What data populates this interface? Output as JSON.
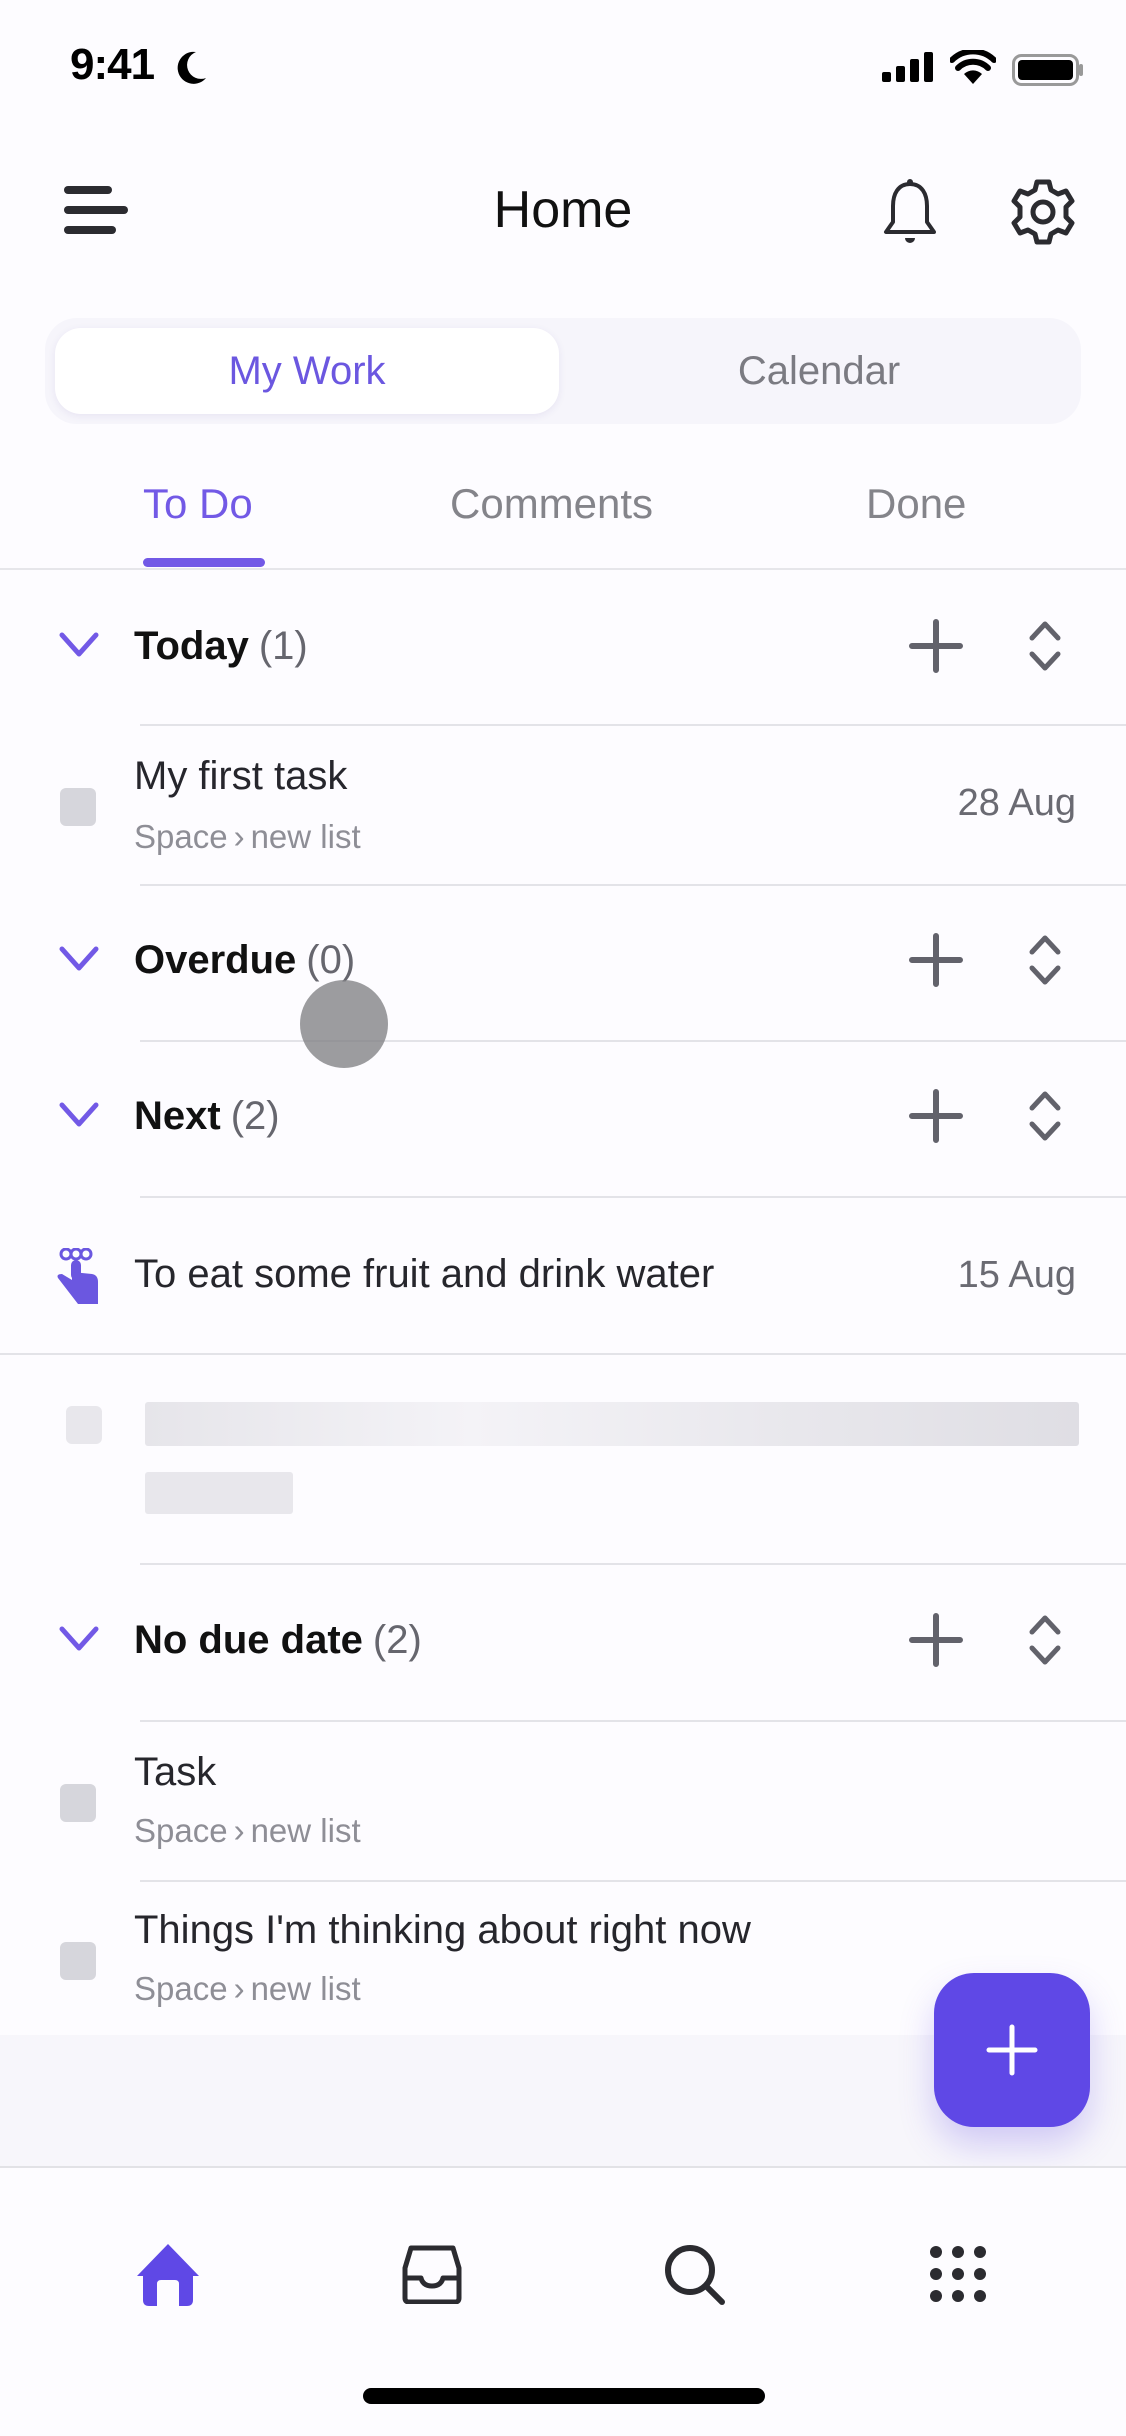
{
  "status_bar": {
    "time": "9:41",
    "focus_icon": "moon-icon",
    "signal": "signal-icon",
    "wifi": "wifi-icon",
    "battery": "battery-icon"
  },
  "header": {
    "title": "Home",
    "menu_icon": "hamburger-icon",
    "notifications_icon": "bell-icon",
    "settings_icon": "gear-icon"
  },
  "segmented": {
    "options": [
      "My Work",
      "Calendar"
    ],
    "selected": "My Work"
  },
  "tabs": {
    "items": [
      "To Do",
      "Comments",
      "Done"
    ],
    "active": "To Do"
  },
  "colors": {
    "accent": "#7259e6",
    "fab": "#5f48e6",
    "text": "#1f1f24",
    "muted": "#8e8e96"
  },
  "sections": [
    {
      "title": "Today",
      "count": "(1)",
      "tasks": [
        {
          "title": "My first task",
          "space": "Space",
          "list": "new list",
          "date": "28 Aug",
          "icon": "checkbox"
        }
      ]
    },
    {
      "title": "Overdue",
      "count": "(0)",
      "tasks": []
    },
    {
      "title": "Next",
      "count": "(2)",
      "tasks": [
        {
          "title": "To eat some fruit and drink water",
          "date": "15 Aug",
          "icon": "reminder-hand-icon"
        }
      ],
      "loading_placeholder": true
    },
    {
      "title": "No due date",
      "count": "(2)",
      "tasks": [
        {
          "title": "Task",
          "space": "Space",
          "list": "new list",
          "icon": "checkbox"
        },
        {
          "title": "Things I'm thinking about right now",
          "space": "Space",
          "list": "new list",
          "icon": "checkbox"
        }
      ]
    }
  ],
  "fab": {
    "icon": "plus-icon"
  },
  "bottom_nav": {
    "items": [
      "home-icon",
      "inbox-icon",
      "search-icon",
      "apps-grid-icon"
    ],
    "active": "home-icon"
  }
}
